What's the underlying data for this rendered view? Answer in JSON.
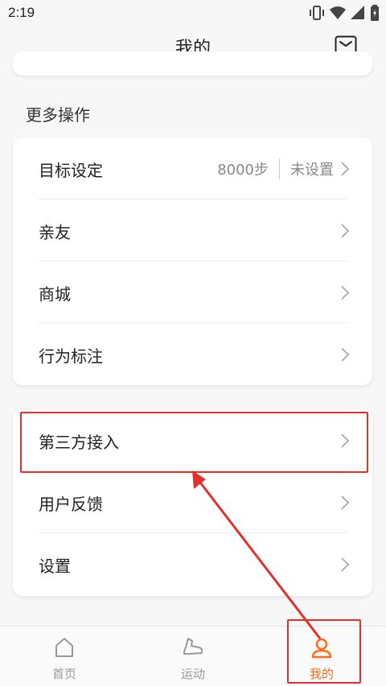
{
  "status_bar": {
    "time": "2:19"
  },
  "header": {
    "title": "我的",
    "mail_icon": "mail-icon"
  },
  "section": {
    "title": "更多操作"
  },
  "card1": {
    "rows": [
      {
        "label": "目标设定",
        "value": "8000步",
        "status": "未设置"
      },
      {
        "label": "亲友"
      },
      {
        "label": "商城"
      },
      {
        "label": "行为标注"
      }
    ]
  },
  "card2": {
    "rows": [
      {
        "label": "第三方接入"
      },
      {
        "label": "用户反馈"
      },
      {
        "label": "设置"
      }
    ]
  },
  "tabbar": {
    "tabs": [
      {
        "label": "首页",
        "icon": "home-icon"
      },
      {
        "label": "运动",
        "icon": "shoe-icon"
      },
      {
        "label": "我的",
        "icon": "person-icon",
        "active": true
      }
    ]
  },
  "colors": {
    "accent": "#ff6a1a",
    "annotation": "#e0312d",
    "background": "#f7f7f7"
  }
}
